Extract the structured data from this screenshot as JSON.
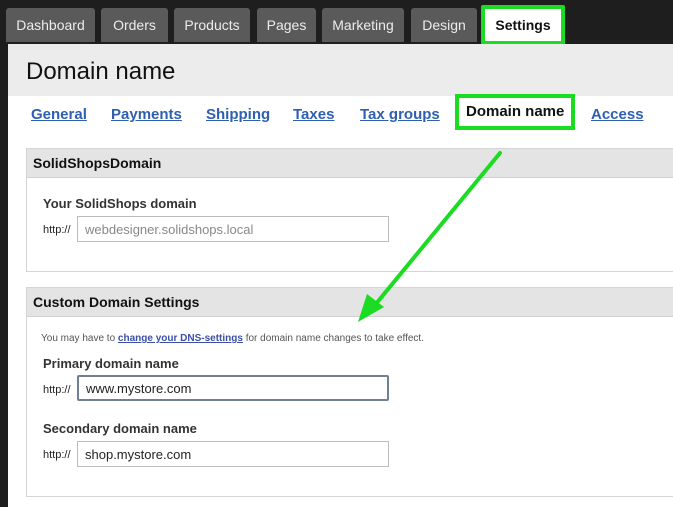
{
  "nav": {
    "tabs": [
      "Dashboard",
      "Orders",
      "Products",
      "Pages",
      "Marketing",
      "Design",
      "Settings"
    ],
    "active": "Settings"
  },
  "page": {
    "title": "Domain name"
  },
  "settings_tabs": {
    "items": [
      "General",
      "Payments",
      "Shipping",
      "Taxes",
      "Tax groups",
      "Domain name",
      "Access"
    ],
    "active": "Domain name"
  },
  "solidshops_panel": {
    "header": "SolidShopsDomain",
    "field_label": "Your SolidShops domain",
    "prefix": "http://",
    "value": "webdesigner.solidshops.local"
  },
  "custom_panel": {
    "header": "Custom Domain Settings",
    "note_before": "You may have to ",
    "note_link": "change your DNS-settings",
    "note_after": " for domain name changes to take effect.",
    "primary_label": "Primary domain name",
    "primary_prefix": "http://",
    "primary_value": "www.mystore.com",
    "secondary_label": "Secondary domain name",
    "secondary_prefix": "http://",
    "secondary_value": "shop.mystore.com"
  },
  "colors": {
    "highlight": "#1bdb22",
    "link": "#2f5fb0",
    "nav_bg": "#1e1e1e",
    "tab_bg": "#5a5a5a"
  },
  "icons": {
    "annotation": "green-arrow-icon"
  }
}
